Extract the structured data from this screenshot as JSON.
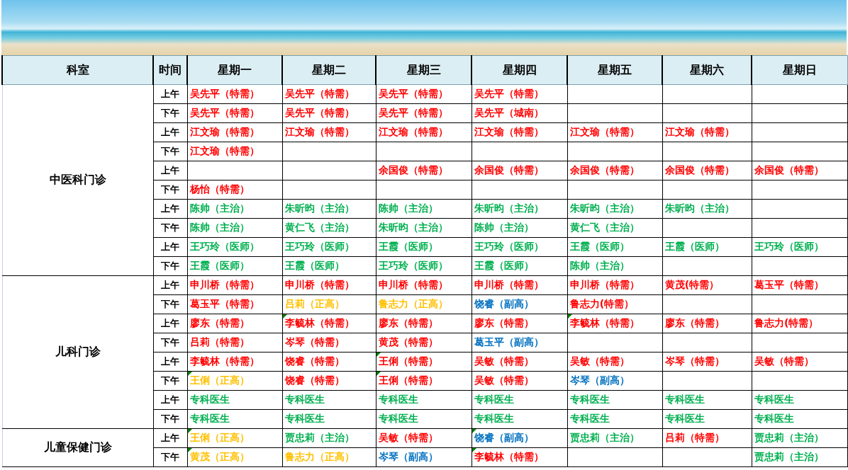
{
  "header": {
    "department": "科室",
    "time": "时间",
    "days": [
      "星期一",
      "星期二",
      "星期三",
      "星期四",
      "星期五",
      "星期六",
      "星期日"
    ]
  },
  "departments": [
    {
      "name": "中医科门诊",
      "rows": [
        {
          "time": "上午",
          "cells": [
            {
              "text": "吴先平（特需）",
              "color": "#ff0000",
              "note": false
            },
            {
              "text": "吴先平（特需）",
              "color": "#ff0000",
              "note": false
            },
            {
              "text": "吴先平（特需）",
              "color": "#ff0000",
              "note": false
            },
            {
              "text": "吴先平（特需）",
              "color": "#ff0000",
              "note": false
            },
            null,
            null,
            null
          ]
        },
        {
          "time": "下午",
          "cells": [
            {
              "text": "吴先平（特需）",
              "color": "#ff0000",
              "note": false
            },
            {
              "text": "吴先平（特需）",
              "color": "#ff0000",
              "note": false
            },
            {
              "text": "吴先平（特需）",
              "color": "#ff0000",
              "note": false
            },
            {
              "text": "吴先平（城南）",
              "color": "#ff0000",
              "note": false
            },
            null,
            null,
            null
          ]
        },
        {
          "time": "上午",
          "cells": [
            {
              "text": "江文瑜（特需）",
              "color": "#ff0000",
              "note": false
            },
            {
              "text": "江文瑜（特需）",
              "color": "#ff0000",
              "note": false
            },
            {
              "text": "江文瑜（特需）",
              "color": "#ff0000",
              "note": false
            },
            {
              "text": "江文瑜（特需）",
              "color": "#ff0000",
              "note": false
            },
            {
              "text": "江文瑜（特需）",
              "color": "#ff0000",
              "note": false
            },
            {
              "text": "江文瑜（特需）",
              "color": "#ff0000",
              "note": false
            },
            null
          ]
        },
        {
          "time": "下午",
          "cells": [
            {
              "text": "江文瑜（特需）",
              "color": "#ff0000",
              "note": false
            },
            null,
            null,
            null,
            null,
            null,
            null
          ]
        },
        {
          "time": "上午",
          "cells": [
            null,
            null,
            {
              "text": "余国俊（特需）",
              "color": "#ff0000",
              "note": false
            },
            {
              "text": "余国俊（特需）",
              "color": "#ff0000",
              "note": false
            },
            {
              "text": "余国俊（特需）",
              "color": "#ff0000",
              "note": false
            },
            {
              "text": "余国俊（特需）",
              "color": "#ff0000",
              "note": false
            },
            {
              "text": "余国俊（特需）",
              "color": "#ff0000",
              "note": false
            }
          ]
        },
        {
          "time": "下午",
          "cells": [
            {
              "text": "杨怡（特需）",
              "color": "#ff0000",
              "note": false
            },
            null,
            null,
            null,
            null,
            null,
            null
          ]
        },
        {
          "time": "上午",
          "cells": [
            {
              "text": "陈帅（主治）",
              "color": "#00b050",
              "note": false
            },
            {
              "text": "朱昕昀（主治）",
              "color": "#00b050",
              "note": false
            },
            {
              "text": "陈帅（主治）",
              "color": "#00b050",
              "note": false
            },
            {
              "text": "朱昕昀（主治）",
              "color": "#00b050",
              "note": false
            },
            {
              "text": "朱昕昀（主治）",
              "color": "#00b050",
              "note": false
            },
            {
              "text": "朱昕昀（主治）",
              "color": "#00b050",
              "note": false
            },
            null
          ]
        },
        {
          "time": "下午",
          "cells": [
            {
              "text": "陈帅（主治）",
              "color": "#00b050",
              "note": false
            },
            {
              "text": "黄仁飞（主治）",
              "color": "#00b050",
              "note": false
            },
            {
              "text": "朱昕昀（主治）",
              "color": "#00b050",
              "note": false
            },
            {
              "text": "陈帅（主治）",
              "color": "#00b050",
              "note": false
            },
            {
              "text": "黄仁飞（主治）",
              "color": "#00b050",
              "note": false
            },
            null,
            null
          ]
        },
        {
          "time": "上午",
          "cells": [
            {
              "text": "王巧玲（医师）",
              "color": "#00b050",
              "note": false
            },
            {
              "text": "王巧玲（医师）",
              "color": "#00b050",
              "note": false
            },
            {
              "text": "王霞（医师）",
              "color": "#00b050",
              "note": false
            },
            {
              "text": "王巧玲（医师）",
              "color": "#00b050",
              "note": false
            },
            {
              "text": "王霞（医师）",
              "color": "#00b050",
              "note": false
            },
            {
              "text": "王霞（医师）",
              "color": "#00b050",
              "note": false
            },
            {
              "text": "王巧玲（医师）",
              "color": "#00b050",
              "note": false
            }
          ]
        },
        {
          "time": "下午",
          "cells": [
            {
              "text": "王霞（医师）",
              "color": "#00b050",
              "note": false
            },
            {
              "text": "王霞（医师）",
              "color": "#00b050",
              "note": false
            },
            {
              "text": "王巧玲（医师）",
              "color": "#00b050",
              "note": false
            },
            {
              "text": "王霞（医师）",
              "color": "#00b050",
              "note": false
            },
            {
              "text": "陈帅（主治）",
              "color": "#00b050",
              "note": false
            },
            null,
            null
          ]
        }
      ]
    },
    {
      "name": "儿科门诊",
      "rows": [
        {
          "time": "上午",
          "cells": [
            {
              "text": "申川桥（特需）",
              "color": "#ff0000",
              "note": false
            },
            {
              "text": "申川桥（特需）",
              "color": "#ff0000",
              "note": false
            },
            {
              "text": "申川桥（特需）",
              "color": "#ff0000",
              "note": false
            },
            {
              "text": "申川桥（特需）",
              "color": "#ff0000",
              "note": false
            },
            {
              "text": "申川桥（特需）",
              "color": "#ff0000",
              "note": false
            },
            {
              "text": "黄茂(特需）",
              "color": "#ff0000",
              "note": false
            },
            {
              "text": "葛玉平（特需）",
              "color": "#ff0000",
              "note": false
            }
          ]
        },
        {
          "time": "下午",
          "cells": [
            {
              "text": "葛玉平（特需）",
              "color": "#ff0000",
              "note": false
            },
            {
              "text": "吕莉（正高）",
              "color": "#ffc000",
              "note": false
            },
            {
              "text": "鲁志力（正高）",
              "color": "#ffc000",
              "note": false
            },
            {
              "text": "饶睿（副高）",
              "color": "#0070c0",
              "note": false
            },
            {
              "text": "鲁志力(特需）",
              "color": "#ff0000",
              "note": false
            },
            null,
            null
          ]
        },
        {
          "time": "上午",
          "cells": [
            {
              "text": "廖东（特需）",
              "color": "#ff0000",
              "note": false
            },
            {
              "text": "李毓林（特需）",
              "color": "#ff0000",
              "note": true
            },
            {
              "text": "廖东（特需）",
              "color": "#ff0000",
              "note": false
            },
            {
              "text": "廖东（特需）",
              "color": "#ff0000",
              "note": false
            },
            {
              "text": "李毓林（特需）",
              "color": "#ff0000",
              "note": true
            },
            {
              "text": "廖东（特需）",
              "color": "#ff0000",
              "note": false
            },
            {
              "text": "鲁志力(特需）",
              "color": "#ff0000",
              "note": false
            }
          ]
        },
        {
          "time": "下午",
          "cells": [
            {
              "text": "吕莉（特需）",
              "color": "#ff0000",
              "note": false
            },
            {
              "text": "岑琴（特需）",
              "color": "#ff0000",
              "note": false
            },
            {
              "text": "黄茂（特需）",
              "color": "#ff0000",
              "note": false
            },
            {
              "text": "葛玉平（副高）",
              "color": "#0070c0",
              "note": false
            },
            null,
            null,
            null
          ]
        },
        {
          "time": "上午",
          "cells": [
            {
              "text": "李毓林（特需）",
              "color": "#ff0000",
              "note": false
            },
            {
              "text": "饶睿（特需）",
              "color": "#ff0000",
              "note": false
            },
            {
              "text": "王俐（特需）",
              "color": "#ff0000",
              "note": true
            },
            {
              "text": "吴敏（特需）",
              "color": "#ff0000",
              "note": false
            },
            {
              "text": "吴敏（特需）",
              "color": "#ff0000",
              "note": false
            },
            {
              "text": "岑琴（特需）",
              "color": "#ff0000",
              "note": false
            },
            {
              "text": "吴敏（特需）",
              "color": "#ff0000",
              "note": false
            }
          ]
        },
        {
          "time": "下午",
          "cells": [
            {
              "text": "王俐（正高）",
              "color": "#ffc000",
              "note": true
            },
            {
              "text": "饶睿（特需）",
              "color": "#ff0000",
              "note": false
            },
            {
              "text": "王俐（特需）",
              "color": "#ff0000",
              "note": true
            },
            {
              "text": "吴敏（特需）",
              "color": "#ff0000",
              "note": false
            },
            {
              "text": "岑琴（副高）",
              "color": "#0070c0",
              "note": false
            },
            null,
            null
          ]
        },
        {
          "time": "上午",
          "cells": [
            {
              "text": "专科医生",
              "color": "#00b050",
              "note": false
            },
            {
              "text": "专科医生",
              "color": "#00b050",
              "note": false
            },
            {
              "text": "专科医生",
              "color": "#00b050",
              "note": false
            },
            {
              "text": "专科医生",
              "color": "#00b050",
              "note": false
            },
            {
              "text": "专科医生",
              "color": "#00b050",
              "note": false
            },
            {
              "text": "专科医生",
              "color": "#00b050",
              "note": false
            },
            {
              "text": "专科医生",
              "color": "#00b050",
              "note": false
            }
          ]
        },
        {
          "time": "下午",
          "cells": [
            {
              "text": "专科医生",
              "color": "#00b050",
              "note": false
            },
            {
              "text": "专科医生",
              "color": "#00b050",
              "note": false
            },
            {
              "text": "专科医生",
              "color": "#00b050",
              "note": false
            },
            {
              "text": "专科医生",
              "color": "#00b050",
              "note": false
            },
            {
              "text": "专科医生",
              "color": "#00b050",
              "note": false
            },
            {
              "text": "专科医生",
              "color": "#00b050",
              "note": false
            },
            {
              "text": "专科医生",
              "color": "#00b050",
              "note": false
            }
          ]
        }
      ]
    },
    {
      "name": "儿童保健门诊",
      "rows": [
        {
          "time": "上午",
          "cells": [
            {
              "text": "王俐（正高）",
              "color": "#ffc000",
              "note": true
            },
            {
              "text": "贾忠莉（主治）",
              "color": "#00b050",
              "note": false
            },
            {
              "text": "吴敏（特需）",
              "color": "#ff0000",
              "note": false
            },
            {
              "text": "饶睿（副高）",
              "color": "#0070c0",
              "note": true
            },
            {
              "text": "贾忠莉（主治）",
              "color": "#00b050",
              "note": false
            },
            {
              "text": "吕莉（特需）",
              "color": "#ff0000",
              "note": false
            },
            {
              "text": "贾忠莉（主治）",
              "color": "#00b050",
              "note": false
            }
          ]
        },
        {
          "time": "下午",
          "cells": [
            {
              "text": "黄茂（正高）",
              "color": "#ffc000",
              "note": true
            },
            {
              "text": "鲁志力（正高）",
              "color": "#ffc000",
              "note": false
            },
            {
              "text": "岑琴（副高）",
              "color": "#0070c0",
              "note": false
            },
            {
              "text": "李毓林（特需）",
              "color": "#ff0000",
              "note": true
            },
            null,
            null,
            {
              "text": "贾忠莉（主治）",
              "color": "#00b050",
              "note": false
            }
          ]
        }
      ]
    }
  ]
}
